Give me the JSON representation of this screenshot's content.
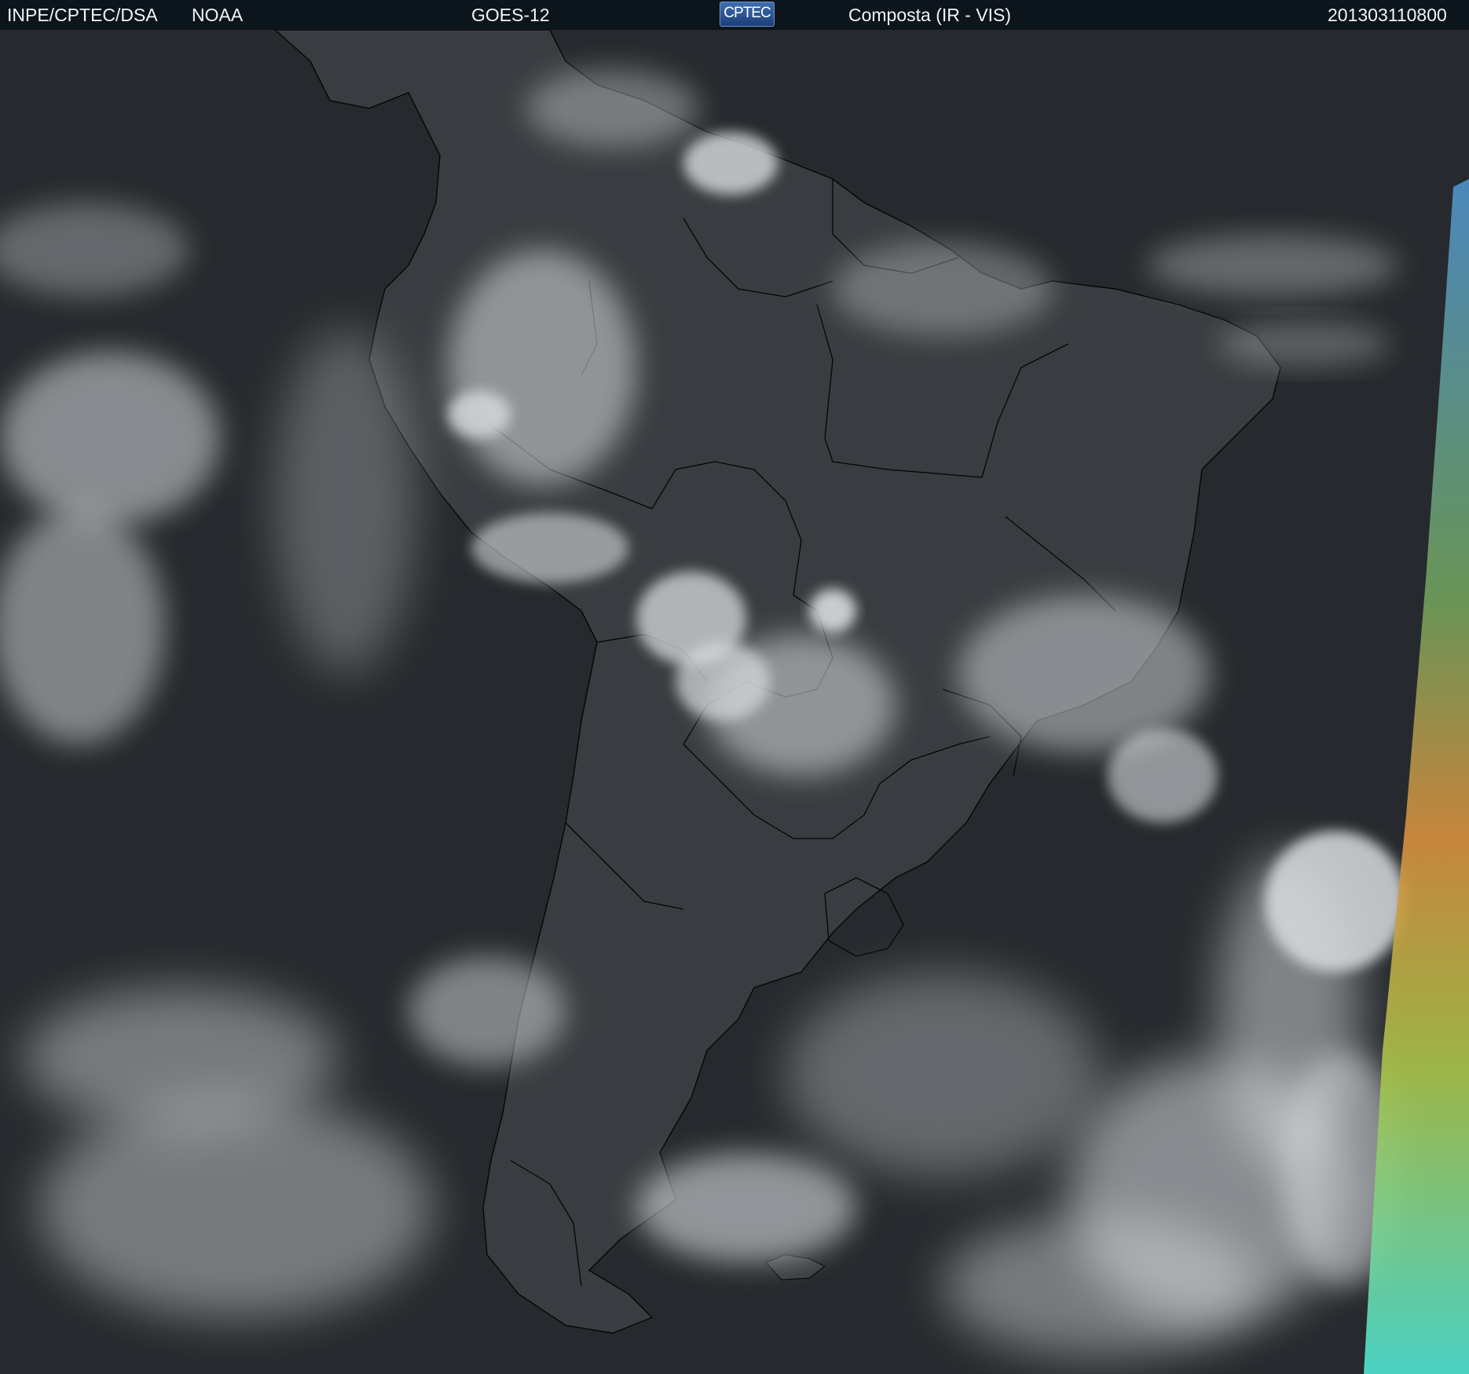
{
  "header": {
    "source": "INPE/CPTEC/DSA",
    "agency": "NOAA",
    "satellite": "GOES-12",
    "logo_text": "CPTEC",
    "product": "Composta (IR - VIS)",
    "timestamp": "201303110800"
  },
  "map": {
    "projection_view": "satellite-composite",
    "colors": {
      "ocean": "#2a2d31",
      "land": "#3a3d41",
      "cloud": "#e4e6e8",
      "border": "#000000",
      "ir_strip": [
        "#d88940",
        "#a8c04a",
        "#52d8c8",
        "#4f8fc8"
      ]
    }
  }
}
